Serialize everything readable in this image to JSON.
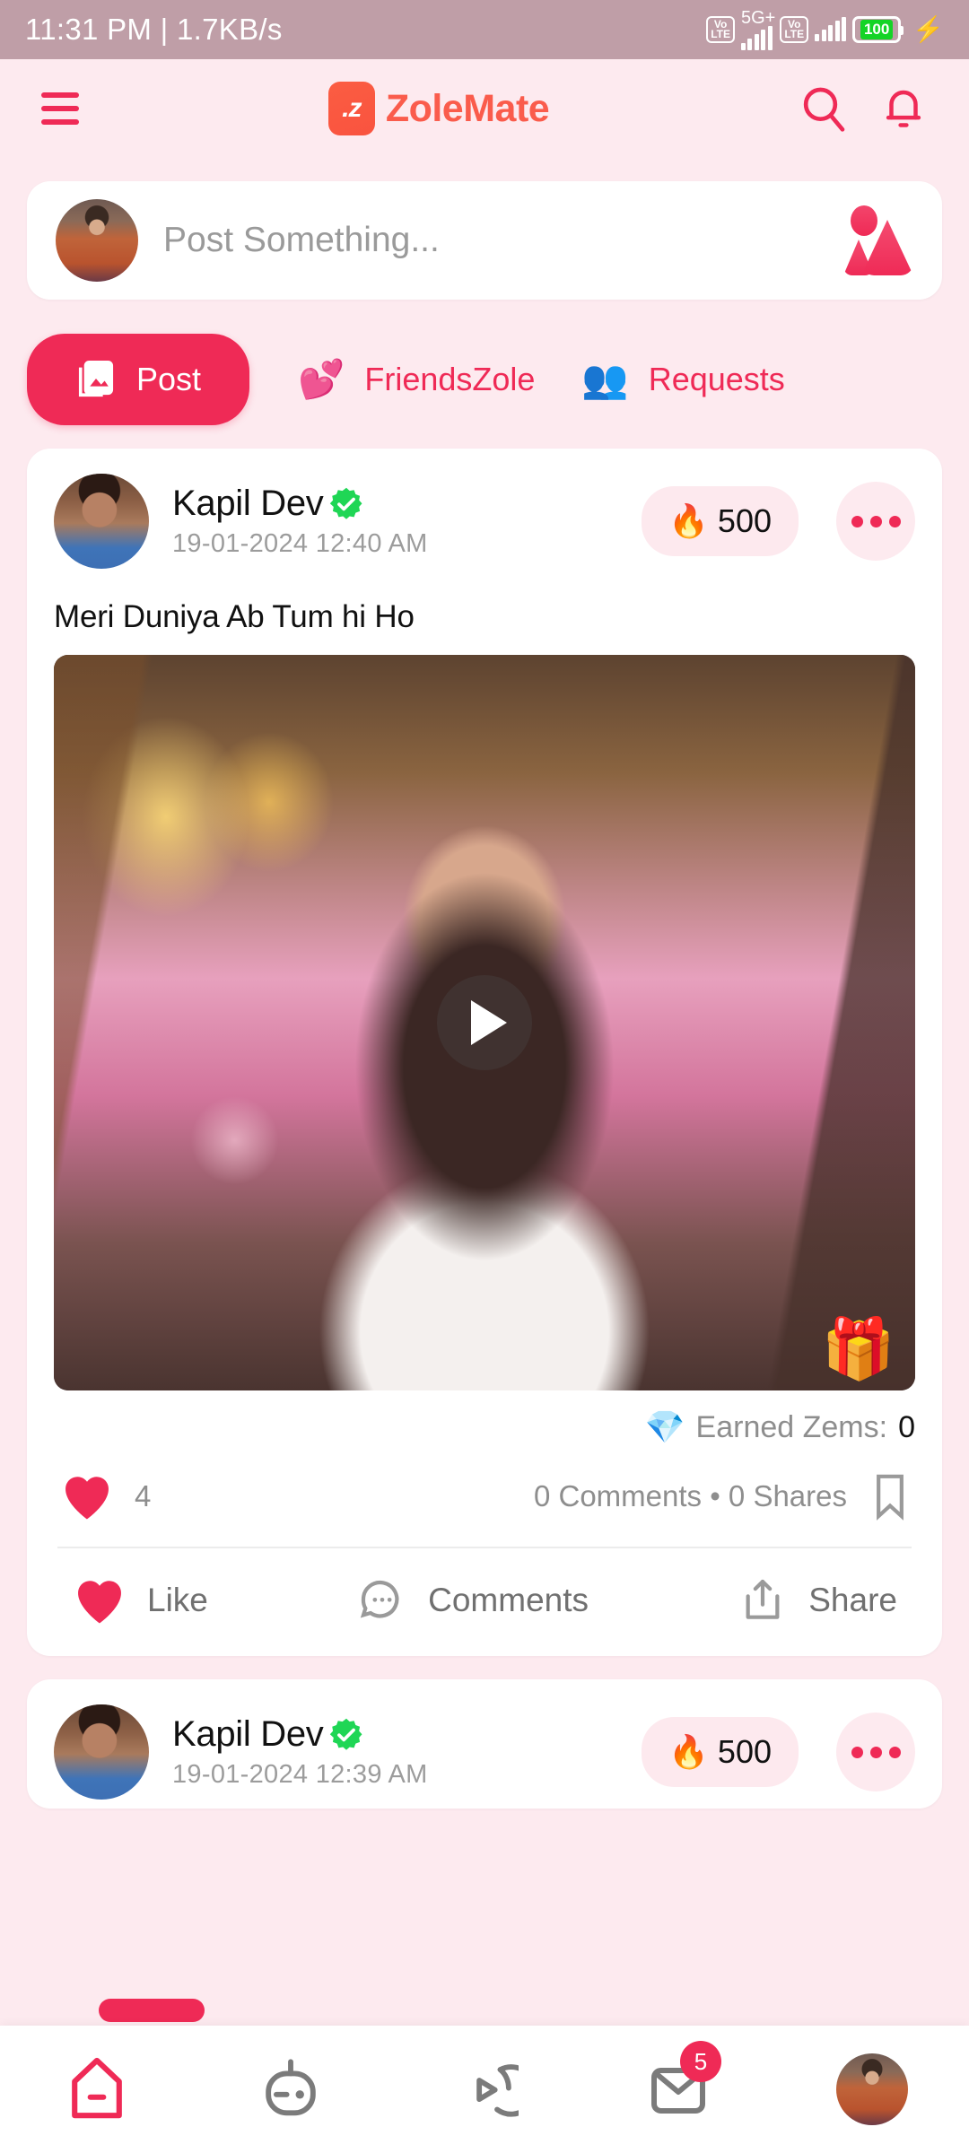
{
  "status_bar": {
    "time_and_speed": "11:31 PM | 1.7KB/s",
    "sim1_volte": "Vo\nLTE",
    "network_label": "5G+",
    "sim2_volte": "Vo\nLTE",
    "battery_percent": "100",
    "charging_icon": "bolt-icon"
  },
  "header": {
    "menu_icon": "hamburger-menu-icon",
    "logo_mark": ".z",
    "brand_name": "ZoleMate",
    "search_icon": "search-icon",
    "notification_icon": "bell-icon"
  },
  "composer": {
    "avatar_name": "current-user-avatar",
    "placeholder": "Post Something...",
    "media_icon": "image-person-icon"
  },
  "tabs": [
    {
      "label": "Post",
      "icon": "gallery-icon",
      "active": true
    },
    {
      "label": "FriendsZole",
      "icon": "hearts-icon",
      "active": false
    },
    {
      "label": "Requests",
      "icon": "people-icon",
      "active": false
    }
  ],
  "posts": [
    {
      "author": "Kapil Dev",
      "verified_icon": "verified-badge-icon",
      "timestamp": "19-01-2024 12:40 AM",
      "flame_icon": "🔥",
      "flame_count": "500",
      "menu_icon": "more-options-icon",
      "caption": "Meri Duniya Ab Tum hi Ho",
      "media_type": "video",
      "play_icon": "play-icon",
      "gift_icon": "🎁",
      "zems_icon": "💎",
      "zems_label": "Earned Zems:",
      "zems_value": "0",
      "likes_count": "4",
      "comments_shares": "0 Comments • 0 Shares",
      "bookmark_icon": "bookmark-icon",
      "actions": [
        {
          "label": "Like",
          "icon": "heart-filled-icon"
        },
        {
          "label": "Comments",
          "icon": "comment-bubble-icon"
        },
        {
          "label": "Share",
          "icon": "share-arrow-icon"
        }
      ]
    },
    {
      "author": "Kapil Dev",
      "verified_icon": "verified-badge-icon",
      "timestamp": "19-01-2024 12:39 AM",
      "flame_icon": "🔥",
      "flame_count": "500",
      "menu_icon": "more-options-icon"
    }
  ],
  "bottom_nav": [
    {
      "name": "home",
      "icon": "home-icon",
      "active": true,
      "badge": ""
    },
    {
      "name": "games",
      "icon": "robot-icon",
      "active": false,
      "badge": ""
    },
    {
      "name": "reels",
      "icon": "play-circle-icon",
      "active": false,
      "badge": ""
    },
    {
      "name": "messages",
      "icon": "envelope-icon",
      "active": false,
      "badge": "5"
    },
    {
      "name": "profile",
      "icon": "profile-avatar",
      "active": false,
      "badge": ""
    }
  ],
  "colors": {
    "accent": "#ef2a56",
    "brand_orange": "#fa5c4c",
    "background": "#fdeaef",
    "status_bar": "#bf9ea7",
    "verified_green": "#1fd655"
  }
}
